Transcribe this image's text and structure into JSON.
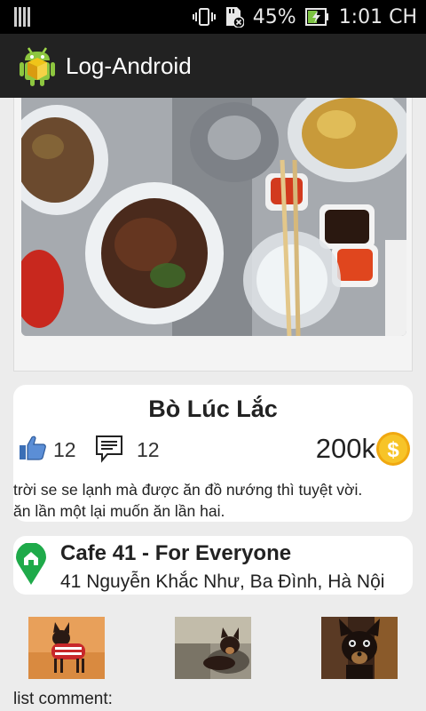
{
  "status_bar": {
    "battery": "45%",
    "time": "1:01 CH"
  },
  "app": {
    "title": "Log-Android"
  },
  "dish": {
    "name": "Bò Lúc Lắc",
    "likes": "12",
    "comments": "12",
    "price": "200k",
    "description_line1": "trời se se lạnh mà được ăn đồ nướng thì tuyệt vời.",
    "description_line2": "ăn lần một lại muốn ăn lần hai."
  },
  "place": {
    "name": "Cafe 41 - For Everyone",
    "address": "41 Nguyễn Khắc Như, Ba Đình, Hà Nội"
  },
  "comments_section": {
    "label": "list comment:"
  },
  "colors": {
    "status_bar": "#000000",
    "action_bar": "#222222",
    "background": "#ececec",
    "coin": "#f5b914",
    "pin": "#1faa4a",
    "like_blue": "#3b6fb6",
    "battery_green": "#7cc242"
  },
  "icons": [
    "android-app-icon",
    "like-icon",
    "comment-icon",
    "coin-icon",
    "location-pin-icon",
    "vibrate-icon",
    "sd-card-icon",
    "battery-charging-icon"
  ]
}
